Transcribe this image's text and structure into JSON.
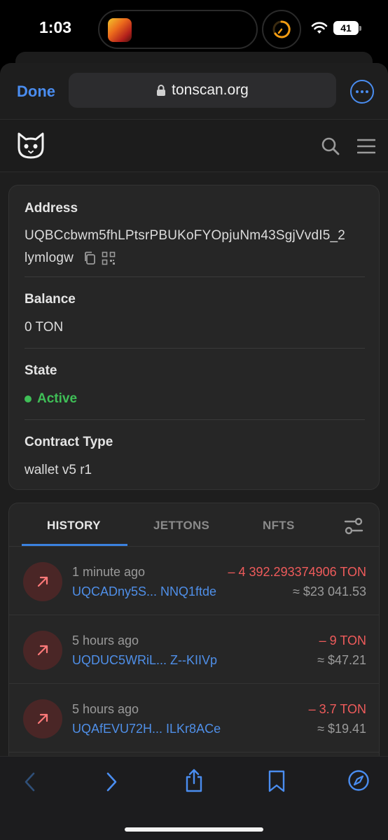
{
  "status": {
    "time": "1:03",
    "battery": "41"
  },
  "browser": {
    "done_label": "Done",
    "url": "tonscan.org"
  },
  "account": {
    "address_label": "Address",
    "address_line1": "UQBCcbwm5fhLPtsrPBUKoFYOpjuNm43SgjVvdI5_2",
    "address_line2": "lymlogw",
    "balance_label": "Balance",
    "balance_value": "0 TON",
    "state_label": "State",
    "state_value": "Active",
    "contract_label": "Contract Type",
    "contract_value": "wallet v5 r1"
  },
  "tabs": [
    {
      "label": "HISTORY",
      "active": true
    },
    {
      "label": "JETTONS",
      "active": false
    },
    {
      "label": "NFTS",
      "active": false
    }
  ],
  "transactions": [
    {
      "time": "1 minute ago",
      "address": "UQCADny5S... NNQ1ftde",
      "amount": "– 4 392.293374906 TON",
      "usd": "≈ $23 041.53"
    },
    {
      "time": "5 hours ago",
      "address": "UQDUC5WRiL... Z--KIIVp",
      "amount": "– 9 TON",
      "usd": "≈ $47.21"
    },
    {
      "time": "5 hours ago",
      "address": "UQAfEVU72H... ILKr8ACe",
      "amount": "– 3.7 TON",
      "usd": "≈ $19.41"
    }
  ],
  "colors": {
    "accent": "#4a8df0",
    "active_green": "#3fbf57",
    "negative_red": "#ef5b5b"
  }
}
